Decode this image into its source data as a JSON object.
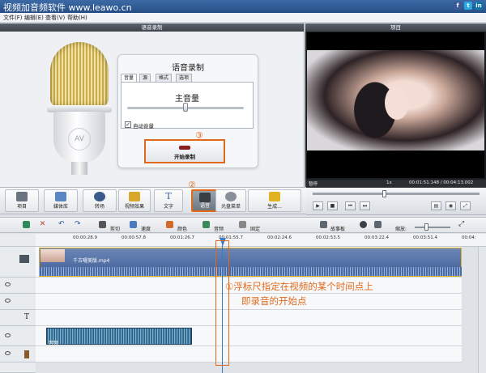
{
  "window": {
    "title": "视频加音频软件 www.leawo.cn"
  },
  "social": [
    "f",
    "t",
    "in"
  ],
  "menu": [
    "文件(F)",
    "编辑(E)",
    "查看(V)",
    "帮助(H)"
  ],
  "panels": {
    "record_title": "语音录制",
    "project_title": "项目"
  },
  "record": {
    "heading": "语音录制",
    "tabs": [
      "音量",
      "源",
      "格式",
      "选项"
    ],
    "volume_label": "主音量",
    "volume_level": 0.5,
    "auto_volume_label": "自动音量",
    "auto_volume_checked": true,
    "start_button": "开始录制"
  },
  "annotations": {
    "n1": "①",
    "n2": "②",
    "n3": "③",
    "note_line1": "浮标尺指定在视频的某个时间点上",
    "note_line2": "即录音的开始点"
  },
  "preview": {
    "state": "暂停",
    "speed": "1x",
    "time": "00:01:51.148 / 00:04:13.002"
  },
  "toolbar": [
    "项目",
    "媒体库",
    "转场",
    "视频效果",
    "文字",
    "语音",
    "光盘菜单",
    "生成..."
  ],
  "edit_toolbar": [
    "剪切",
    "速度",
    "颜色",
    "音频",
    "固定",
    "故事板",
    "缩放:"
  ],
  "ruler": [
    "00:00:28.9",
    "00:00:57.8",
    "00:01:26.7",
    "00:01:55.7",
    "00:02:24.6",
    "00:02:53.5",
    "00:03:22.4",
    "00:03:51.4",
    "00:04:"
  ],
  "clips": {
    "video_name": "千古曜美版.mp4",
    "audio_name": "音频"
  },
  "colors": {
    "accent": "#e06a1a",
    "title_bar": "#2f5b96",
    "panel_head": "#4a525b"
  },
  "icons": [
    "mic-icon",
    "play-icon",
    "stop-icon",
    "skip-back-icon",
    "skip-forward-icon",
    "camera-icon",
    "fullscreen-icon",
    "eye-icon",
    "lock-icon"
  ]
}
